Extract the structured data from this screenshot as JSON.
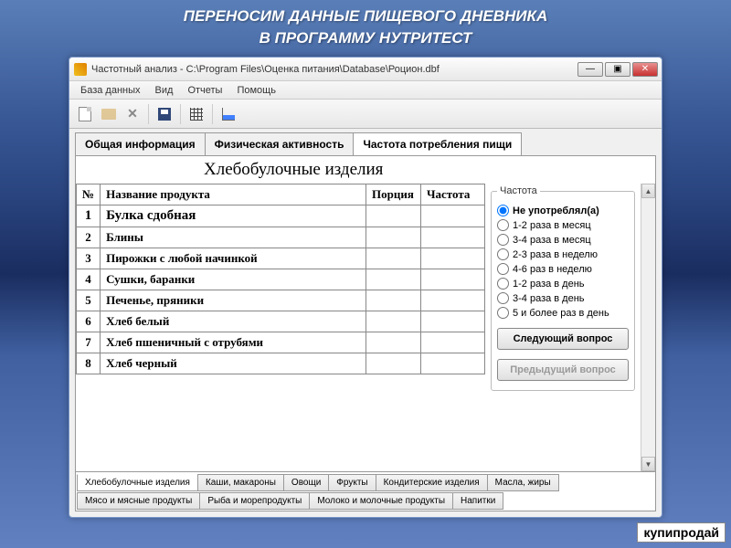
{
  "overlay": {
    "title_line1": "ПЕРЕНОСИМ ДАННЫЕ ПИЩЕВОГО ДНЕВНИКА",
    "title_line2": "В ПРОГРАММУ НУТРИТЕСТ"
  },
  "window": {
    "title": "Частотный анализ - C:\\Program Files\\Оценка питания\\Database\\Роцион.dbf",
    "controls": {
      "min": "—",
      "max": "▣",
      "close": "✕"
    }
  },
  "menubar": [
    "База данных",
    "Вид",
    "Отчеты",
    "Помощь"
  ],
  "tabs": {
    "items": [
      {
        "label": "Общая информация"
      },
      {
        "label": "Физическая активность"
      },
      {
        "label": "Частота потребления пищи"
      }
    ],
    "active": 2
  },
  "section_title": "Хлебобулочные изделия",
  "table": {
    "headers": {
      "num": "№",
      "name": "Название продукта",
      "portion": "Порция",
      "freq": "Частота"
    },
    "rows": [
      {
        "num": "1",
        "name": "Булка сдобная",
        "portion": "",
        "freq": "",
        "selected": true
      },
      {
        "num": "2",
        "name": "Блины",
        "portion": "",
        "freq": ""
      },
      {
        "num": "3",
        "name": "Пирожки с любой начинкой",
        "portion": "",
        "freq": ""
      },
      {
        "num": "4",
        "name": "Сушки, баранки",
        "portion": "",
        "freq": ""
      },
      {
        "num": "5",
        "name": "Печенье, пряники",
        "portion": "",
        "freq": ""
      },
      {
        "num": "6",
        "name": "Хлеб белый",
        "portion": "",
        "freq": ""
      },
      {
        "num": "7",
        "name": "Хлеб пшеничный с отрубями",
        "portion": "",
        "freq": ""
      },
      {
        "num": "8",
        "name": "Хлеб черный",
        "portion": "",
        "freq": ""
      }
    ]
  },
  "freq_panel": {
    "legend": "Частота",
    "options": [
      "Не употреблял(а)",
      "1-2 раза в месяц",
      "3-4 раза в месяц",
      "2-3 раза в неделю",
      "4-6 раз в неделю",
      "1-2 раза в день",
      "3-4 раза в день",
      "5 и более раз в день"
    ],
    "selected": 0,
    "next_btn": "Следующий вопрос",
    "prev_btn": "Предыдущий вопрос"
  },
  "bottom_tabs": [
    "Хлебобулочные изделия",
    "Каши, макароны",
    "Овощи",
    "Фрукты",
    "Кондитерские изделия",
    "Масла, жиры",
    "Мясо и мясные продукты",
    "Рыба и морепродукты",
    "Молоко и молочные продукты",
    "Напитки"
  ],
  "bottom_active": 0,
  "watermark": "купипродай"
}
